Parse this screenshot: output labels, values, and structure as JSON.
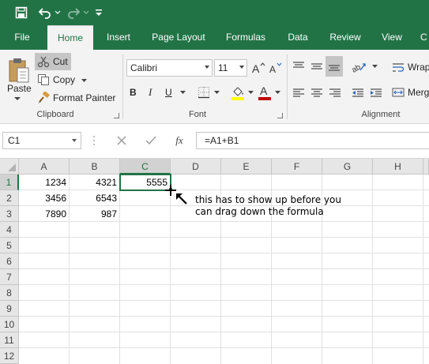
{
  "qat": {
    "save_icon": "save-icon",
    "undo_icon": "undo-icon",
    "redo_icon": "redo-icon",
    "customize_icon": "customize-qat-icon"
  },
  "tabs": [
    {
      "label": "File"
    },
    {
      "label": "Home"
    },
    {
      "label": "Insert"
    },
    {
      "label": "Page Layout"
    },
    {
      "label": "Formulas"
    },
    {
      "label": "Data"
    },
    {
      "label": "Review"
    },
    {
      "label": "View"
    },
    {
      "label": "C"
    }
  ],
  "ribbon": {
    "clipboard": {
      "paste": "Paste",
      "cut": "Cut",
      "copy": "Copy",
      "format_painter": "Format Painter",
      "label": "Clipboard"
    },
    "font": {
      "font_name": "Calibri",
      "font_size": "11",
      "bold": "B",
      "italic": "I",
      "underline": "U",
      "label": "Font",
      "highlight_color": "#ffff00",
      "font_color": "#c00000"
    },
    "alignment": {
      "wrap": "Wrap",
      "merge": "Merg",
      "label": "Alignment"
    }
  },
  "formula_bar": {
    "name_box": "C1",
    "fx": "fx",
    "formula": "=A1+B1"
  },
  "grid": {
    "columns": [
      "A",
      "B",
      "C",
      "D",
      "E",
      "F",
      "G",
      "H"
    ],
    "rows": [
      "1",
      "2",
      "3",
      "4",
      "5",
      "6",
      "7",
      "8",
      "9",
      "10",
      "11",
      "12",
      "13"
    ],
    "cells": {
      "A1": "1234",
      "B1": "4321",
      "C1": "5555",
      "A2": "3456",
      "B2": "6543",
      "A3": "7890",
      "B3": "987"
    }
  },
  "annotation": {
    "line1": "this has to show up before you",
    "line2": "can drag down the formula"
  },
  "colors": {
    "accent": "#217346"
  }
}
